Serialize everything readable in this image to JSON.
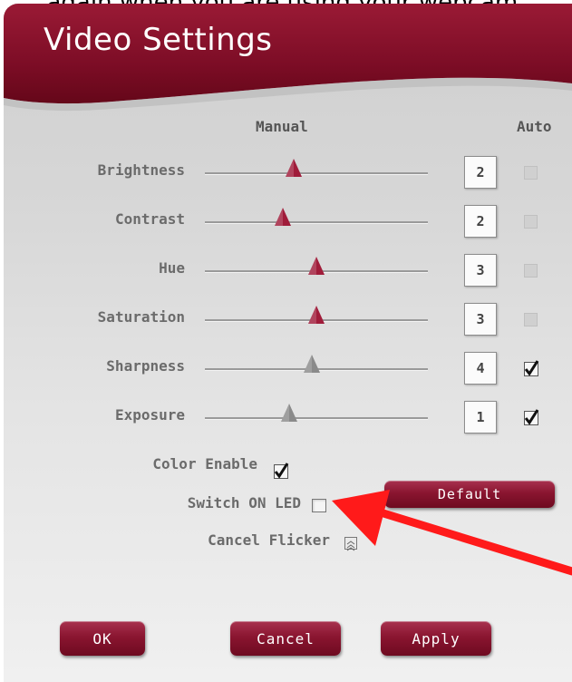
{
  "caption": "again when you are using your webcam.",
  "window": {
    "title": "Video Settings"
  },
  "columns": {
    "manual": "Manual",
    "auto": "Auto"
  },
  "sliders": [
    {
      "label": "Brightness",
      "value": "2",
      "auto": false,
      "enabled": true,
      "level": 0.4
    },
    {
      "label": "Contrast",
      "value": "2",
      "auto": false,
      "enabled": true,
      "level": 0.35
    },
    {
      "label": "Hue",
      "value": "3",
      "auto": false,
      "enabled": true,
      "level": 0.5
    },
    {
      "label": "Saturation",
      "value": "3",
      "auto": false,
      "enabled": true,
      "level": 0.5
    },
    {
      "label": "Sharpness",
      "value": "4",
      "auto": true,
      "enabled": false,
      "level": 0.48
    },
    {
      "label": "Exposure",
      "value": "1",
      "auto": true,
      "enabled": false,
      "level": 0.38
    }
  ],
  "options": {
    "color_enable": {
      "label": "Color Enable",
      "checked": true
    },
    "switch_led": {
      "label": "Switch ON LED",
      "checked": false
    },
    "cancel_flicker": {
      "label": "Cancel Flicker"
    }
  },
  "buttons": {
    "default": "Default",
    "ok": "OK",
    "cancel": "Cancel",
    "apply": "Apply"
  },
  "colors": {
    "accent": "#8a1530",
    "thumb_active": "#a01c3a",
    "thumb_disabled": "#8a8a8a",
    "arrow": "#ff0000"
  }
}
